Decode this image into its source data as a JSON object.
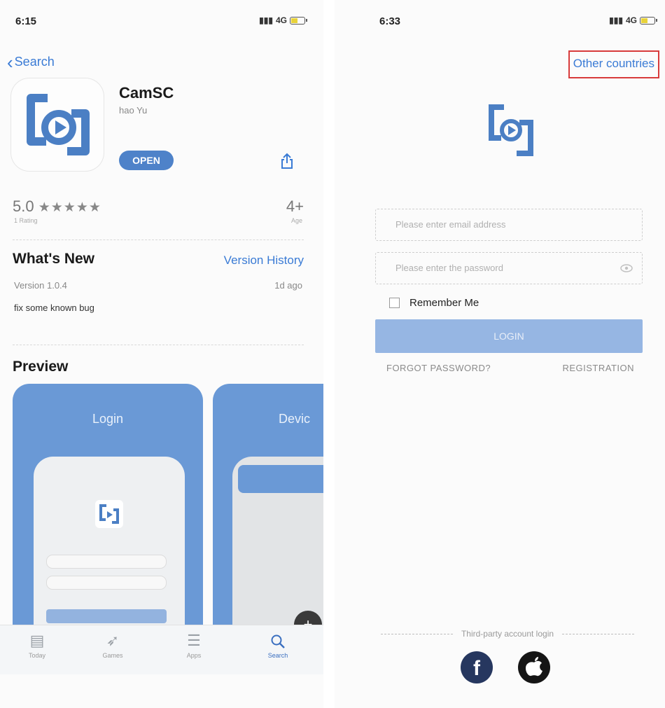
{
  "app_store": {
    "status": {
      "time": "6:15",
      "signal": "4G"
    },
    "back_label": "Search",
    "app": {
      "name": "CamSC",
      "developer": "hao Yu",
      "open_label": "OPEN",
      "rating_value": "5.0",
      "rating_stars": "★★★★★",
      "ratings_count": "1 Rating",
      "age": "4+",
      "age_label": "Age"
    },
    "whats_new": {
      "title": "What's New",
      "version_history": "Version History",
      "version": "Version 1.0.4",
      "ago": "1d ago",
      "notes": "fix some known bug"
    },
    "preview": {
      "title": "Preview",
      "screens": [
        "Login",
        "Devic"
      ]
    },
    "tabs": [
      {
        "label": "Today",
        "icon": "today-icon"
      },
      {
        "label": "Games",
        "icon": "games-icon"
      },
      {
        "label": "Apps",
        "icon": "apps-icon"
      },
      {
        "label": "Search",
        "icon": "search-icon"
      }
    ]
  },
  "login": {
    "status": {
      "time": "6:33",
      "signal": "4G"
    },
    "other_countries": "Other countries",
    "email_placeholder": "Please enter email address",
    "password_placeholder": "Please enter the password",
    "remember_me": "Remember Me",
    "login_button": "LOGIN",
    "forgot_password": "FORGOT PASSWORD?",
    "registration": "REGISTRATION",
    "third_party": "Third-party account login",
    "highlight_color": "#d83b3b",
    "accent_color": "#3a7bd5"
  }
}
